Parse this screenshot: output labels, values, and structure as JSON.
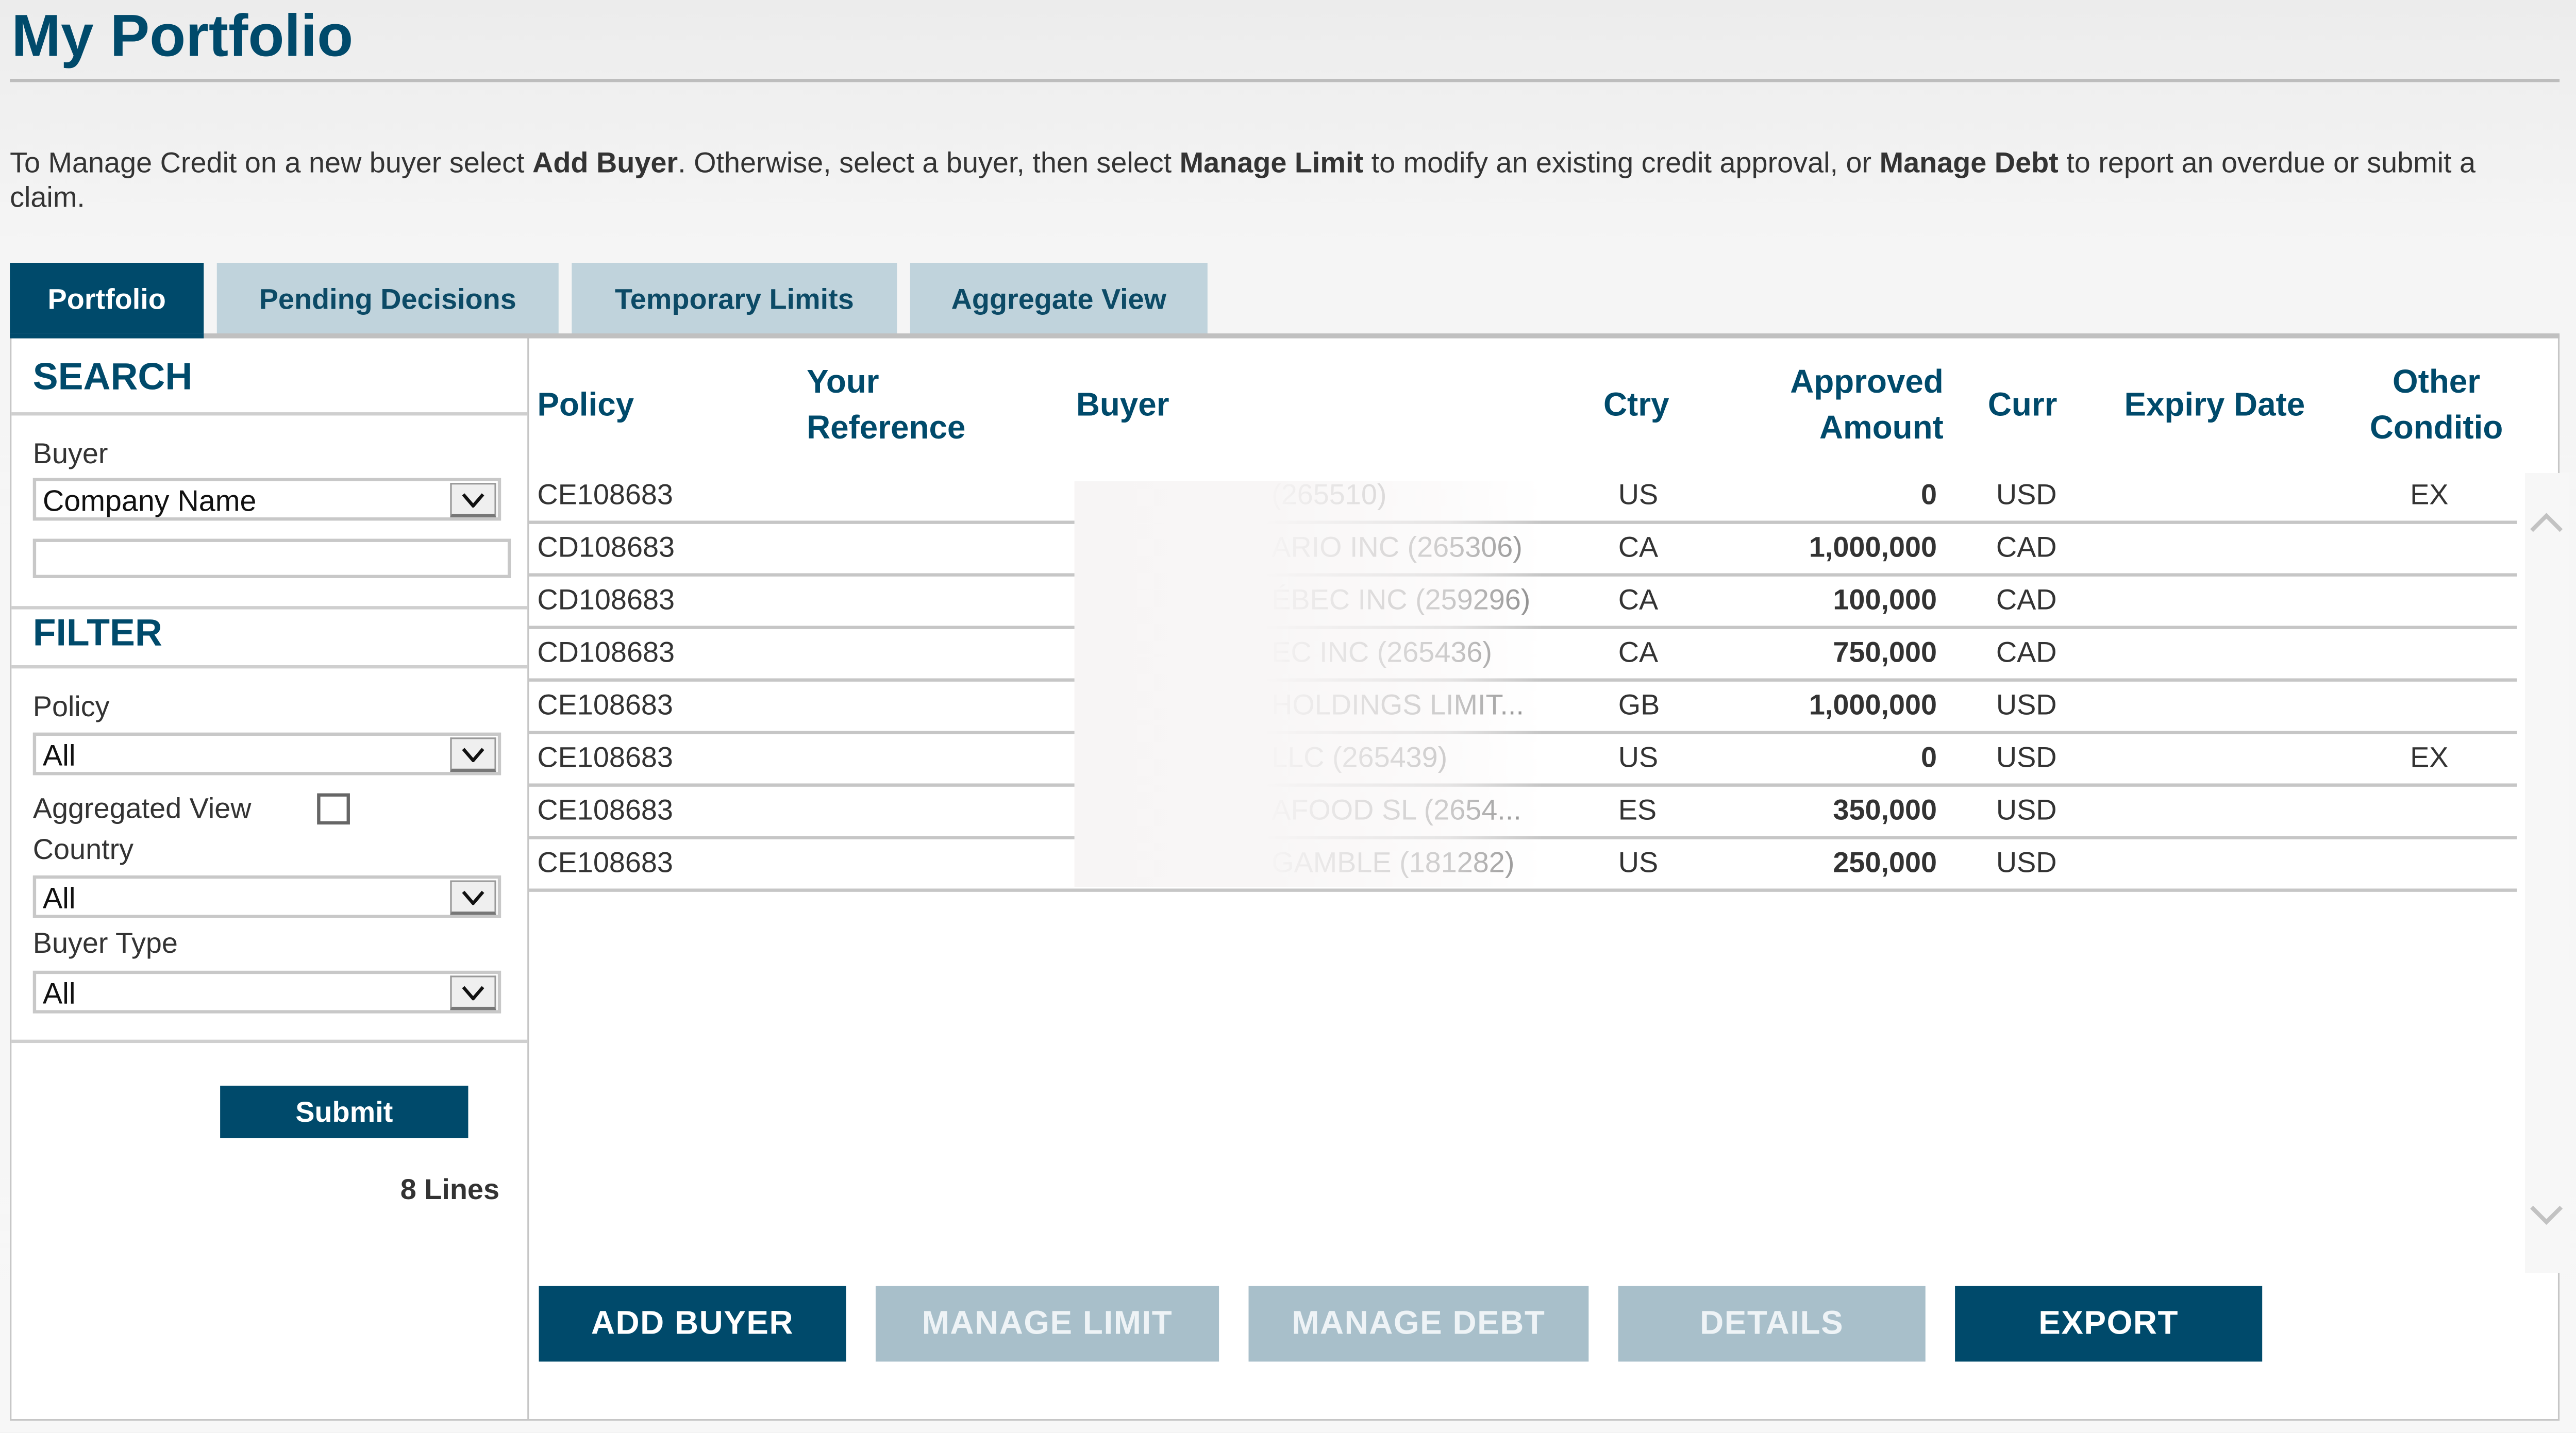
{
  "page": {
    "title": "My Portfolio",
    "intro": {
      "p1": "To Manage Credit on a new buyer select ",
      "b1": "Add Buyer",
      "p2": ". Otherwise, select a buyer, then select ",
      "b2": "Manage Limit",
      "p3": " to modify an existing credit approval, or ",
      "b3": "Manage Debt",
      "p4": " to report an overdue or submit a claim."
    }
  },
  "tabs": [
    {
      "label": "Portfolio",
      "active": true
    },
    {
      "label": "Pending Decisions",
      "active": false
    },
    {
      "label": "Temporary Limits",
      "active": false
    },
    {
      "label": "Aggregate View",
      "active": false
    }
  ],
  "sidebar": {
    "search": {
      "heading": "SEARCH",
      "buyer_label": "Buyer",
      "buyer_type_select": "Company Name",
      "buyer_input_value": ""
    },
    "filter": {
      "heading": "FILTER",
      "policy_label": "Policy",
      "policy_value": "All",
      "aggregated_label": "Aggregated View",
      "aggregated_checked": false,
      "country_label": "Country",
      "country_value": "All",
      "buyer_type_label": "Buyer Type",
      "buyer_type_value": "All"
    },
    "submit_label": "Submit",
    "line_count": "8 Lines"
  },
  "table": {
    "headers": {
      "policy": "Policy",
      "your_ref_1": "Your",
      "your_ref_2": "Reference",
      "buyer": "Buyer",
      "ctry": "Ctry",
      "approved_1": "Approved",
      "approved_2": "Amount",
      "curr": "Curr",
      "expiry": "Expiry Date",
      "other_1": "Other",
      "other_2": "Conditio"
    },
    "rows": [
      {
        "policy": "CE108683",
        "your_ref": "",
        "buyer": "(265510)",
        "ctry": "US",
        "amount": "0",
        "curr": "USD",
        "expiry": "",
        "other": "EX"
      },
      {
        "policy": "CD108683",
        "your_ref": "",
        "buyer": "ARIO INC (265306)",
        "ctry": "CA",
        "amount": "1,000,000",
        "curr": "CAD",
        "expiry": "",
        "other": ""
      },
      {
        "policy": "CD108683",
        "your_ref": "",
        "buyer": "ÉBEC INC (259296)",
        "ctry": "CA",
        "amount": "100,000",
        "curr": "CAD",
        "expiry": "",
        "other": ""
      },
      {
        "policy": "CD108683",
        "your_ref": "",
        "buyer": "EC INC (265436)",
        "ctry": "CA",
        "amount": "750,000",
        "curr": "CAD",
        "expiry": "",
        "other": ""
      },
      {
        "policy": "CE108683",
        "your_ref": "",
        "buyer": "HOLDINGS LIMIT...",
        "ctry": "GB",
        "amount": "1,000,000",
        "curr": "USD",
        "expiry": "",
        "other": ""
      },
      {
        "policy": "CE108683",
        "your_ref": "",
        "buyer": "LLC (265439)",
        "ctry": "US",
        "amount": "0",
        "curr": "USD",
        "expiry": "",
        "other": "EX"
      },
      {
        "policy": "CE108683",
        "your_ref": "",
        "buyer": "AFOOD SL (2654...",
        "ctry": "ES",
        "amount": "350,000",
        "curr": "USD",
        "expiry": "",
        "other": ""
      },
      {
        "policy": "CE108683",
        "your_ref": "",
        "buyer": "GAMBLE (181282)",
        "ctry": "US",
        "amount": "250,000",
        "curr": "USD",
        "expiry": "",
        "other": ""
      }
    ]
  },
  "actions": {
    "add_buyer": "ADD BUYER",
    "manage_limit": "MANAGE LIMIT",
    "manage_debt": "MANAGE DEBT",
    "details": "DETAILS",
    "export": "EXPORT"
  },
  "colors": {
    "brand": "#004a6b",
    "tab_inactive": "#c0d3dc",
    "button_disabled": "#a8bfca"
  }
}
